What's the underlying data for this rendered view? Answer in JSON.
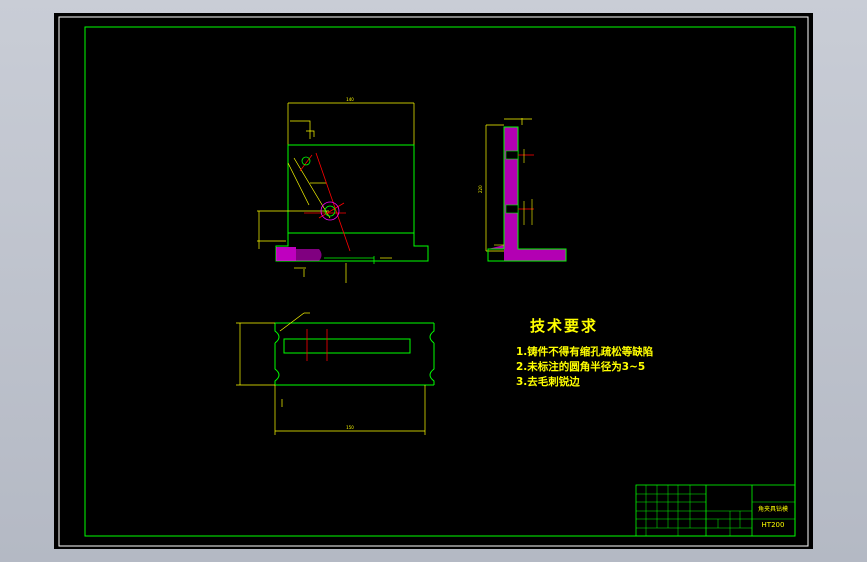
{
  "technical_requirements": {
    "title": "技术要求",
    "items": [
      "1.铸件不得有缩孔疏松等缺陷",
      "2.未标注的圆角半径为3~5",
      "3.去毛刺锐边"
    ]
  },
  "title_block": {
    "part_name": "角夹具钻模",
    "material": "HT200"
  },
  "colors": {
    "background": "#000000",
    "frame": "#00ff00",
    "dimension": "#ffff00",
    "centerline": "#ff0000",
    "section_hatch": "#ff00ff",
    "text": "#ffff00"
  }
}
